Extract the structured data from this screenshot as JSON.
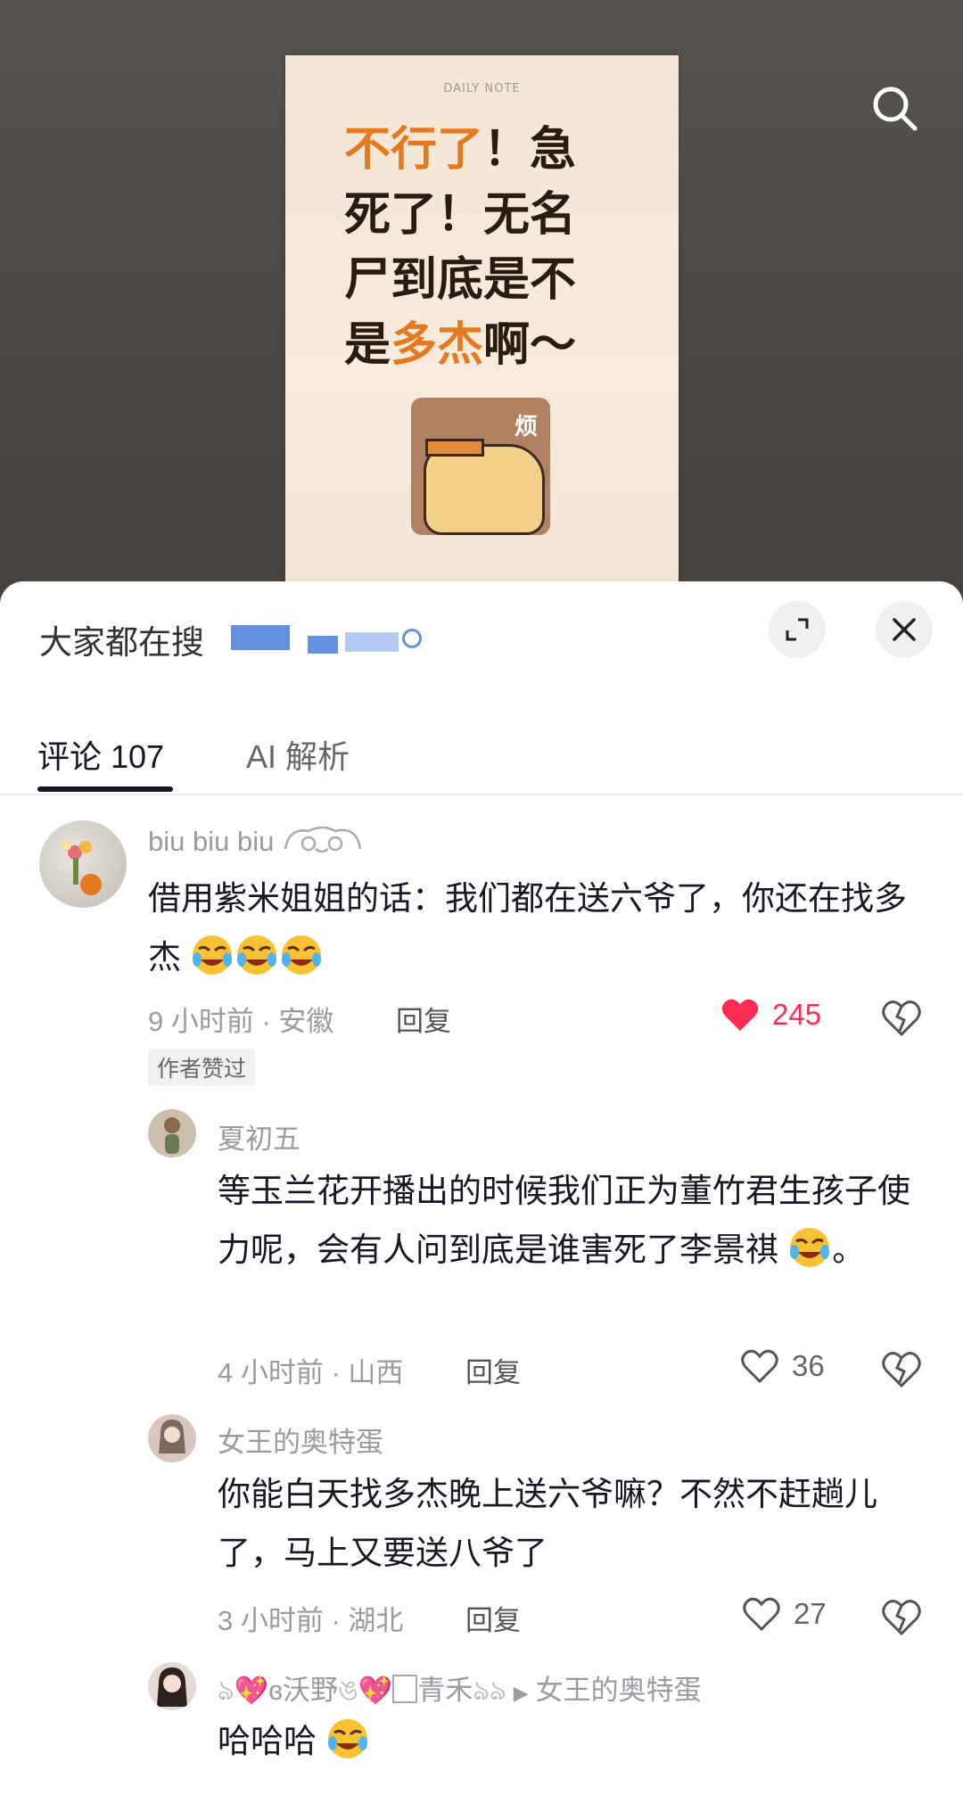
{
  "video": {
    "note_header": "DAILY NOTE",
    "note_lines": [
      {
        "parts": [
          {
            "t": "不行了",
            "hl": true
          },
          {
            "t": "！急",
            "hl": false
          }
        ]
      },
      {
        "parts": [
          {
            "t": "死了！无名",
            "hl": false
          }
        ]
      },
      {
        "parts": [
          {
            "t": "尸到底是不",
            "hl": false
          }
        ]
      },
      {
        "parts": [
          {
            "t": "是",
            "hl": false
          },
          {
            "t": "多杰",
            "hl": true
          },
          {
            "t": "啊～",
            "hl": false
          }
        ]
      }
    ],
    "sticker_label": "烦"
  },
  "sheet": {
    "hot_search_label": "大家都在搜",
    "tabs": {
      "comments": "评论 107",
      "ai": "AI 解析"
    }
  },
  "comments": [
    {
      "user": "biu biu biu",
      "text": "借用紫米姐姐的话：我们都在送六爷了，你还在找多杰",
      "emoji_count": 3,
      "time_loc": "9 小时前 · 安徽",
      "reply": "回复",
      "likes": "245",
      "liked": true,
      "badge": "作者赞过"
    },
    {
      "user": "夏初五",
      "text": "等玉兰花开播出的时候我们正为董竹君生孩子使力呢，会有人问到底是谁害死了李景祺",
      "after_emoji": "。",
      "time_loc": "4 小时前 · 山西",
      "reply": "回复",
      "likes": "36",
      "liked": false
    },
    {
      "user": "女王的奥特蛋",
      "text": "你能白天找多杰晚上送六爷嘛？不然不赶趟儿了，马上又要送八爷了",
      "time_loc": "3 小时前 · 湖北",
      "reply": "回复",
      "likes": "27",
      "liked": false
    },
    {
      "user": "沃野",
      "user_b": "青禾",
      "reply_to": "女王的奥特蛋",
      "text": "哈哈哈"
    }
  ],
  "colors": {
    "accent_red": "#fe2c55",
    "highlight_orange": "#e37a1f"
  }
}
